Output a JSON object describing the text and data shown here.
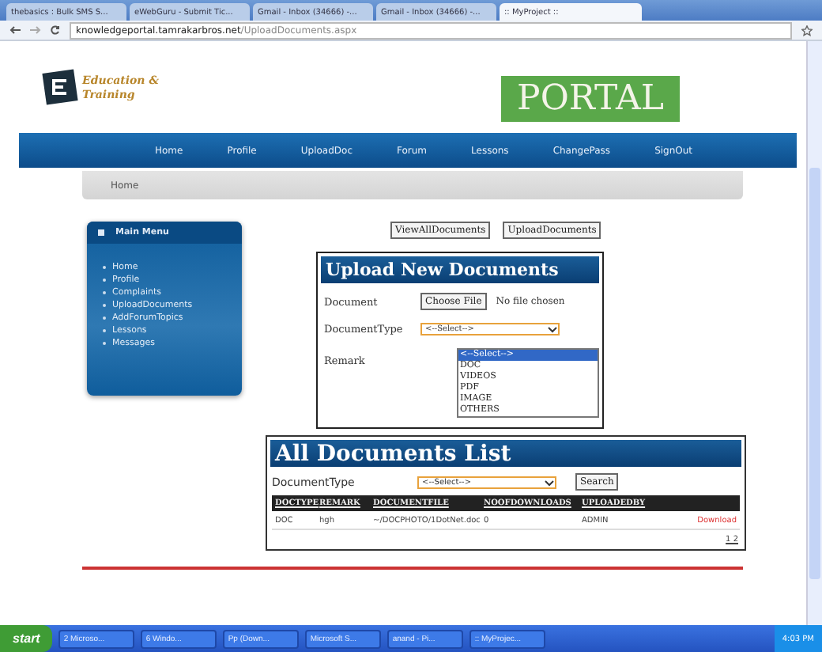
{
  "browser": {
    "tabs": [
      {
        "label": "thebasics : Bulk SMS S...",
        "selected": false
      },
      {
        "label": "eWebGuru - Submit Tic...",
        "selected": false
      },
      {
        "label": "Gmail - Inbox (34666) -...",
        "selected": false
      },
      {
        "label": "Gmail - Inbox (34666) -...",
        "selected": false
      },
      {
        "label": ":: MyProject ::",
        "selected": true
      }
    ],
    "address": {
      "host": "knowledgeportal.tamrakarbros.net",
      "path": "/UploadDocuments.aspx"
    }
  },
  "header": {
    "logo_line_1": "Education &",
    "logo_line_2": "Training",
    "portal": "PORTAL"
  },
  "nav": [
    "Home",
    "Profile",
    "UploadDoc",
    "Forum",
    "Lessons",
    "ChangePass",
    "SignOut"
  ],
  "breadcrumb": "Home",
  "main_menu": {
    "title": "Main Menu",
    "items": [
      "Home",
      "Profile",
      "Complaints",
      "UploadDocuments",
      "AddForumTopics",
      "Lessons",
      "Messages"
    ]
  },
  "view_buttons": [
    "ViewAllDocuments",
    "UploadDocuments"
  ],
  "upload_panel": {
    "title": "Upload New Documents",
    "document_label": "Document",
    "choose_button": "Choose File",
    "file_status": "No file chosen",
    "type_label": "DocumentType",
    "type_value": "<--Select-->",
    "remark_label": "Remark",
    "options": [
      {
        "label": "<--Select-->",
        "selected": true
      },
      {
        "label": "DOC",
        "selected": false
      },
      {
        "label": "VIDEOS",
        "selected": false
      },
      {
        "label": "PDF",
        "selected": false
      },
      {
        "label": "IMAGE",
        "selected": false
      },
      {
        "label": "OTHERS",
        "selected": false
      }
    ]
  },
  "list_panel": {
    "title": "All Documents List",
    "filter_label": "DocumentType",
    "filter_value": "<--Select-->",
    "search_button": "Search",
    "columns": [
      "DOCTYPE",
      "REMARK",
      "DOCUMENTFILE",
      "NOOFDOWNLOADS",
      "UPLOADEDBY"
    ],
    "rows": [
      {
        "cells": [
          "DOC",
          "hgh",
          "~/DOCPHOTO/1DotNet.doc",
          "0",
          "ADMIN"
        ],
        "action": "Download"
      }
    ],
    "pager": "1 2"
  },
  "taskbar": {
    "start": "start",
    "items": [
      "2 Microso...",
      "6 Windo...",
      "Pp (Down...",
      "Microsoft S...",
      "anand - Pi...",
      ":: MyProjec..."
    ],
    "clock": "4:03 PM"
  }
}
